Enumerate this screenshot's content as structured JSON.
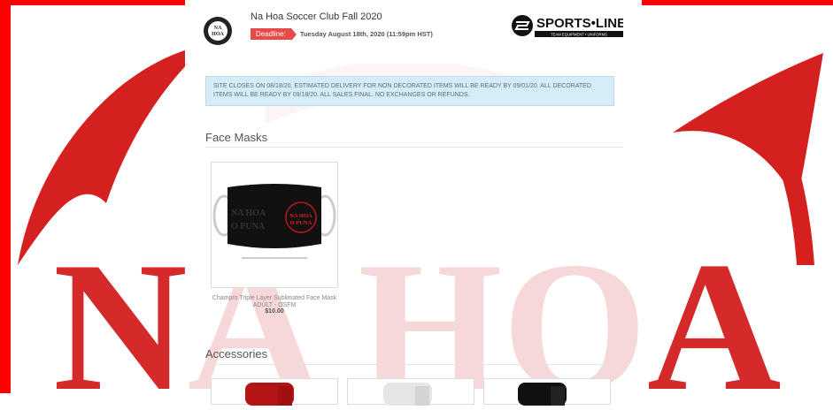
{
  "header": {
    "title": "Na Hoa Soccer Club Fall 2020",
    "deadline_label": "Deadline:",
    "deadline_date": "Tuesday August 18th, 2020 (11:59pm HST)",
    "brand": "SPORTS•LINE",
    "brand_sub": "TEAM EQUIPMENT • UNIFORMS"
  },
  "notice": "SITE  CLOSES ON 08/18/20. ESTIMATED DELIVERY FOR NON DECORATED ITEMS WILL BE READY BY 09/01/20. ALL DECORATED ITEMS WILL BE READY BY 09/18/20. ALL SALES FINAL. NO EXCHANGES OR REFUNDS.",
  "sections": {
    "face_masks": "Face Masks",
    "accessories": "Accessories"
  },
  "products": [
    {
      "name": "Champro Triple Layer Sublimated Face Mask ADULT - OSFM",
      "price": "$10.00"
    }
  ],
  "mask_print": {
    "left": "NA HOA",
    "left2": "O PUNA",
    "right": "NA HOA",
    "right2": "O PUNA"
  },
  "background_text": "NA HOA",
  "colors": {
    "accent": "#ff0000",
    "brand_red": "#cc1f1f",
    "notice_bg": "#d6ecf6"
  }
}
